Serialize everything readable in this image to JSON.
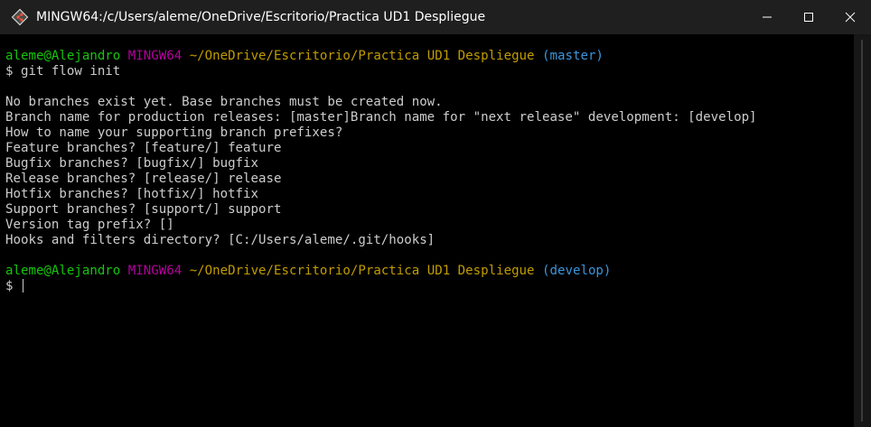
{
  "window": {
    "title": "MINGW64:/c/Users/aleme/OneDrive/Escritorio/Practica UD1 Despliegue",
    "icon": "git-bash-icon",
    "controls": [
      "minimize-icon",
      "maximize-icon",
      "close-icon"
    ]
  },
  "terminal": {
    "prompt1": {
      "user": "aleme@Alejandro",
      "host": "MINGW64",
      "path": "~/OneDrive/Escritorio/Practica UD1 Despliegue",
      "branch": "(master)"
    },
    "command1": "$ git flow init",
    "output": [
      "No branches exist yet. Base branches must be created now.",
      "Branch name for production releases: [master]Branch name for \"next release\" development: [develop]",
      "How to name your supporting branch prefixes?",
      "Feature branches? [feature/] feature",
      "Bugfix branches? [bugfix/] bugfix",
      "Release branches? [release/] release",
      "Hotfix branches? [hotfix/] hotfix",
      "Support branches? [support/] support",
      "Version tag prefix? []",
      "Hooks and filters directory? [C:/Users/aleme/.git/hooks]"
    ],
    "prompt2": {
      "user": "aleme@Alejandro",
      "host": "MINGW64",
      "path": "~/OneDrive/Escritorio/Practica UD1 Despliegue",
      "branch": "(develop)"
    },
    "command2": "$ "
  },
  "colors": {
    "user": "#16c60c",
    "host": "#b4009e",
    "path": "#c19c00",
    "branch": "#3a96dd",
    "text": "#cccccc",
    "background": "#000000"
  }
}
